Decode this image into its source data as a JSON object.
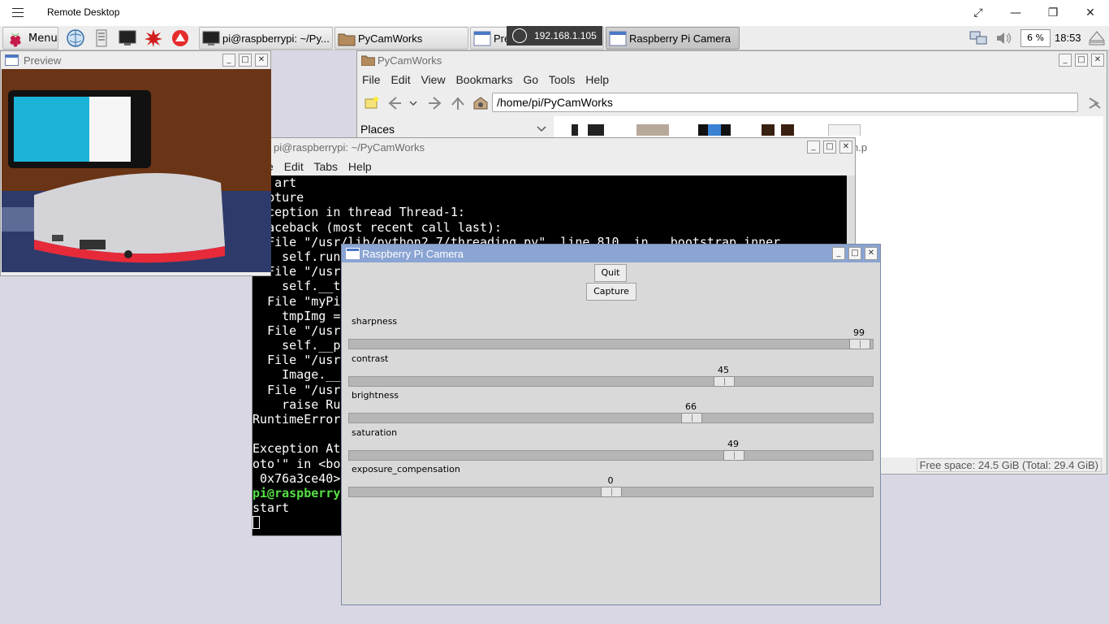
{
  "remote_desktop": {
    "title": "Remote Desktop",
    "ip": "192.168.1.105"
  },
  "panel": {
    "menu_label": "Menu",
    "tasks": [
      {
        "label": "pi@raspberrypi: ~/Py..."
      },
      {
        "label": "PyCamWorks"
      },
      {
        "label": "Pre"
      },
      {
        "label": "Raspberry Pi Camera"
      }
    ],
    "cpu": "6 %",
    "time": "18:53"
  },
  "preview": {
    "title": "Preview"
  },
  "file_manager": {
    "title": "PyCamWorks",
    "menu": [
      "File",
      "Edit",
      "View",
      "Bookmarks",
      "Go",
      "Tools",
      "Help"
    ],
    "path": "/home/pi/PyCamWorks",
    "places": "Places",
    "partial_file": "n.p",
    "free_space": "Free space: 24.5 GiB (Total: 29.4 GiB)"
  },
  "terminal": {
    "title": "pi@raspberrypi: ~/PyCamWorks",
    "menu": [
      "e",
      "Edit",
      "Tabs",
      "Help"
    ],
    "lines": [
      {
        "text": "art",
        "indent": "   ",
        "green": false
      },
      {
        "text": "pture",
        "indent": "  ",
        "green": false
      },
      {
        "text": "ception in thread Thread-1:",
        "indent": "  ",
        "green": false
      },
      {
        "text": "aceback (most recent call last):",
        "indent": "  ",
        "green": false
      },
      {
        "text": "File \"/usr/lib/python2.7/threading.py\", line 810, in __bootstrap_inner",
        "indent": "  ",
        "green": false
      },
      {
        "text": "self.run",
        "indent": "    ",
        "green": false
      },
      {
        "text": "File \"/usr",
        "indent": "  ",
        "green": false
      },
      {
        "text": "self.__t",
        "indent": "    ",
        "green": false
      },
      {
        "text": "File \"myPi",
        "indent": "  ",
        "green": false
      },
      {
        "text": "tmpImg =",
        "indent": "    ",
        "green": false
      },
      {
        "text": "File \"/usr",
        "indent": "  ",
        "green": false
      },
      {
        "text": "self.__p",
        "indent": "    ",
        "green": false
      },
      {
        "text": "File \"/usr",
        "indent": "  ",
        "green": false
      },
      {
        "text": "Image.__",
        "indent": "    ",
        "green": false
      },
      {
        "text": "File \"/usr",
        "indent": "  ",
        "green": false
      },
      {
        "text": "raise Ru",
        "indent": "    ",
        "green": false
      },
      {
        "text": "RuntimeError",
        "indent": "",
        "green": false
      },
      {
        "text": "",
        "indent": "",
        "green": false
      },
      {
        "text": "Exception At",
        "indent": "",
        "green": false
      },
      {
        "text": "oto'\" in <bo",
        "indent": "",
        "green": false
      },
      {
        "text": " 0x76a3ce40>",
        "indent": "",
        "green": false
      },
      {
        "text": "pi@raspberry",
        "indent": "",
        "green": true
      },
      {
        "text": "start",
        "indent": "",
        "green": false
      }
    ]
  },
  "camera": {
    "title": "Raspberry Pi Camera",
    "quit_label": "Quit",
    "capture_label": "Capture",
    "sliders": [
      {
        "label": "sharpness",
        "value": "99",
        "min": -100,
        "max": 100
      },
      {
        "label": "contrast",
        "value": "45",
        "min": -100,
        "max": 100
      },
      {
        "label": "brightness",
        "value": "66",
        "min": 0,
        "max": 100
      },
      {
        "label": "saturation",
        "value": "49",
        "min": -100,
        "max": 100
      },
      {
        "label": "exposure_compensation",
        "value": "0",
        "min": -25,
        "max": 25
      }
    ]
  }
}
